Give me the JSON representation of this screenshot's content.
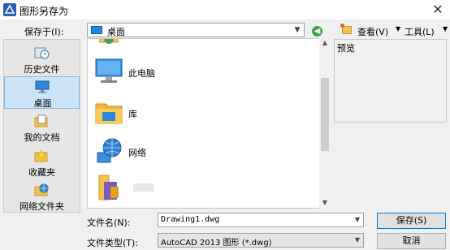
{
  "window": {
    "title": "图形另存为",
    "close": "✕"
  },
  "save_in": {
    "label": "保存于(I):",
    "value": "桌面"
  },
  "toolbar": {
    "view": "查看(V)",
    "tools": "工具(L)"
  },
  "places": [
    {
      "label": "历史文件",
      "icon": "history-icon"
    },
    {
      "label": "桌面",
      "icon": "desktop-icon",
      "selected": true
    },
    {
      "label": "我的文档",
      "icon": "documents-icon"
    },
    {
      "label": "收藏夹",
      "icon": "favorites-icon"
    },
    {
      "label": "网络文件夹",
      "icon": "network-folder-icon"
    }
  ],
  "files": [
    {
      "name": "此电脑",
      "icon": "computer-icon"
    },
    {
      "name": "库",
      "icon": "library-icon"
    },
    {
      "name": "网络",
      "icon": "network-icon"
    }
  ],
  "preview": {
    "label": "预览"
  },
  "filename": {
    "label": "文件名(N):",
    "value": "Drawing1.dwg"
  },
  "filetype": {
    "label": "文件类型(T):",
    "value": "AutoCAD 2013 图形 (*.dwg)"
  },
  "buttons": {
    "save": "保存(S)",
    "cancel": "取消"
  },
  "colors": {
    "accent": "#0078d7",
    "selection": "#cce4f7"
  }
}
